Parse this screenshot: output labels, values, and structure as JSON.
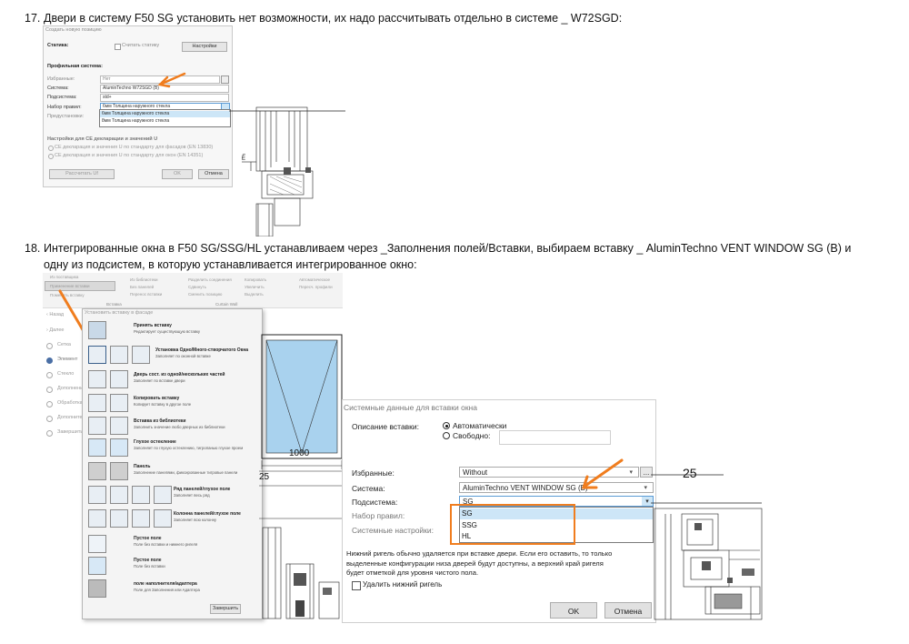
{
  "item17": {
    "number": "17.",
    "text": "Двери в систему F50 SG установить нет возможности, их надо рассчитывать отдельно в системе _ W72SGD:"
  },
  "item18": {
    "number": "18.",
    "line1": "Интегрированные окна в F50 SG/SSG/HL устанавливаем через _Заполнения полей/Вставки, выбираем вставку _ AluminTechno VENT WINDOW SG (B) и",
    "line2": "одну из подсистем, в которую устанавливается интегрированное окно:"
  },
  "small_dialog": {
    "title": "Создать новую позицию",
    "statics_label": "Статика:",
    "calc_checkbox": "Считать статику",
    "settings_btn": "Настройки",
    "section_profile": "Профильная система:",
    "fav_label": "Избранные:",
    "fav_value": "Нет",
    "system_label": "Система:",
    "system_value": "AluminTechno W72SGD (B)",
    "subsystem_label": "Подсистема:",
    "subsystem_value": "std+",
    "rules_label": "Набор правил:",
    "rules_value": "6мм Толщина наружного стекла",
    "presets_label": "Предустановки:",
    "dropdown_items": [
      "6мм Толщина наружного стекла",
      "8мм Толщина наружного стекла"
    ],
    "ce_header": "Настройки для CE декларации и значений U",
    "ce_opt1": "CE декларация и значения U по стандарту для фасадов (EN 13830)",
    "ce_opt2": "CE декларация и значения U по стандарту для окон (EN 14351)",
    "recalc_btn": "Рассчитать Uf",
    "ok_btn": "OK",
    "cancel_btn": "Отмена"
  },
  "ribbon": {
    "items": [
      "Из поставщика",
      "Применение вставки",
      "Поменять вставку",
      "Из библиотеки",
      "Без панелей",
      "Перенос вставки",
      "Разделить соединения",
      "Сдвинуть",
      "Сменить позицию",
      "Копировать",
      "Увеличить",
      "Выделить",
      "Разделить сегменты",
      "Регистр. под. элементы",
      "Автоматическое",
      "Пересч. профили"
    ],
    "group1": "Вставка",
    "group2": "Curtain Wall"
  },
  "sidebar": {
    "items": [
      "Назад",
      "Далее",
      "Сетка",
      "Элемент",
      "Стекло",
      "Дополнения",
      "Обработка",
      "Дополнительно",
      "Завершить"
    ]
  },
  "insert_menu": {
    "title": "Установить вставку в фасаде",
    "rows": [
      {
        "title": "Принять вставку",
        "sub": "Редактирует существующую вставку"
      },
      {
        "title": "Установка Одно/Много-створчатого Окна",
        "sub": "Заполняет по оконной вставке"
      },
      {
        "title": "Дверь сост. из одной/нескольких частей",
        "sub": "Заполняет по вставке двери"
      },
      {
        "title": "Копировать вставку",
        "sub": "Копирует вставку в другое поле"
      },
      {
        "title": "Вставка из библиотеки",
        "sub": "Заполнить значение любо дверных из библиотеки"
      },
      {
        "title": "Глухое остекление",
        "sub": "Заполняет по глухую остеклению, тигропанью глухое проем"
      },
      {
        "title": "Панель",
        "sub": "Заполнение панелями, фиксированные тигровые панели"
      },
      {
        "title": "Ряд панелей/глухое поле",
        "sub": "Заполняет весь ряд"
      },
      {
        "title": "Колонна панелей/глухое поле",
        "sub": "Заполняет всю колонну"
      },
      {
        "title": "Пустое поле",
        "sub": "Поле без вставки и нижнего ригеля"
      },
      {
        "title": "Пустое поле",
        "sub": "Поле без вставки"
      },
      {
        "title": "поле наполнителя/адаптера",
        "sub": "Поле для Заполнения или Адаптера"
      }
    ],
    "close_btn": "Завершить"
  },
  "drawing": {
    "dim_width": "1000",
    "dim_25_left": "25",
    "dim_25_right": "25",
    "label_E": "E"
  },
  "big_dialog": {
    "title": "Системные данные для вставки окна",
    "desc_label": "Описание вставки:",
    "radio_auto": "Автоматически",
    "radio_free": "Свободно:",
    "fav_label": "Избранные:",
    "fav_value": "Without",
    "system_label": "Система:",
    "system_value": "AluminTechno VENT WINDOW SG (B)",
    "subsystem_label": "Подсистема:",
    "subsystem_value": "SG",
    "rules_label": "Набор правил:",
    "system_settings_label": "Системные настройки:",
    "dropdown_items": [
      "SG",
      "SSG",
      "HL"
    ],
    "note": "Нижний ригель обычно удаляется при вставке двери. Если его оставить, то только выделенные конфигурации низа дверей будут доступны, а верхний край ригеля будет отметкой для уровня чистого пола.",
    "checkbox_label": "Удалить нижний ригель",
    "ok_btn": "OK",
    "cancel_btn": "Отмена",
    "ellipsis_btn": "..."
  },
  "colors": {
    "accent_orange": "#f07d1e",
    "selection_blue": "#cde6f7",
    "glass_blue": "#a9d2ee"
  }
}
